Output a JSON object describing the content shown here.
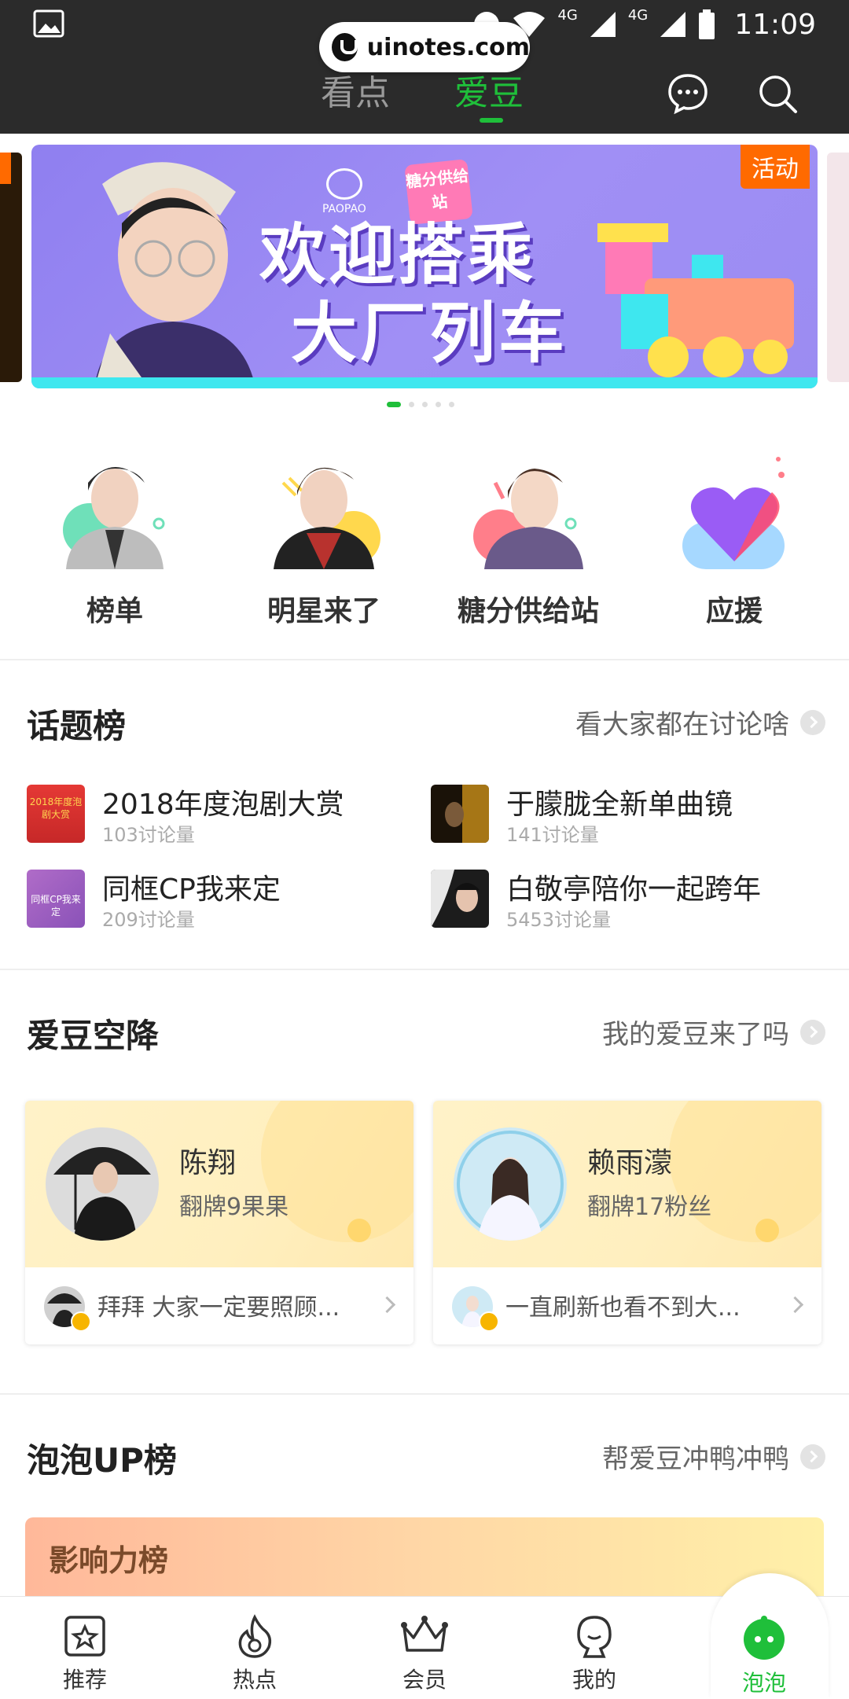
{
  "watermark": "uinotes.com",
  "status": {
    "signal1": "4G",
    "signal2": "4G",
    "time": "11:09"
  },
  "header": {
    "tabs": [
      {
        "label": "看点"
      },
      {
        "label": "爱豆"
      }
    ]
  },
  "banner": {
    "badge": "活动",
    "headline_line1": "欢迎搭乘",
    "headline_line2": "大厂列车",
    "brand": "PAOPAO",
    "sub_tag": "糖分供给站"
  },
  "entries": [
    {
      "label": "榜单"
    },
    {
      "label": "明星来了"
    },
    {
      "label": "糖分供给站"
    },
    {
      "label": "应援"
    }
  ],
  "topics": {
    "title": "话题榜",
    "more": "看大家都在讨论啥",
    "items": [
      {
        "title": "2018年度泡剧大赏",
        "count": "103讨论量",
        "thumb_text": "2018年度泡剧大赏"
      },
      {
        "title": "于朦胧全新单曲镜",
        "count": "141讨论量"
      },
      {
        "title": "同框CP我来定",
        "count": "209讨论量",
        "thumb_text": "同框CP我来定"
      },
      {
        "title": "白敬亭陪你一起跨年",
        "count": "5453讨论量"
      }
    ]
  },
  "idols": {
    "title": "爱豆空降",
    "more": "我的爱豆来了吗",
    "cards": [
      {
        "name": "陈翔",
        "fans": "翻牌9果果",
        "message": "拜拜 大家一定要照顾..."
      },
      {
        "name": "赖雨濛",
        "fans": "翻牌17粉丝",
        "message": "一直刷新也看不到大..."
      }
    ]
  },
  "uprank": {
    "title": "泡泡UP榜",
    "more": "帮爱豆冲鸭冲鸭",
    "banner_title": "影响力榜"
  },
  "nav": [
    {
      "label": "推荐"
    },
    {
      "label": "热点"
    },
    {
      "label": "会员"
    },
    {
      "label": "我的"
    },
    {
      "label": "泡泡"
    }
  ],
  "colors": {
    "accent": "#1fbf3a",
    "header_bg": "#2b2b2b",
    "badge": "#ff6a00"
  }
}
